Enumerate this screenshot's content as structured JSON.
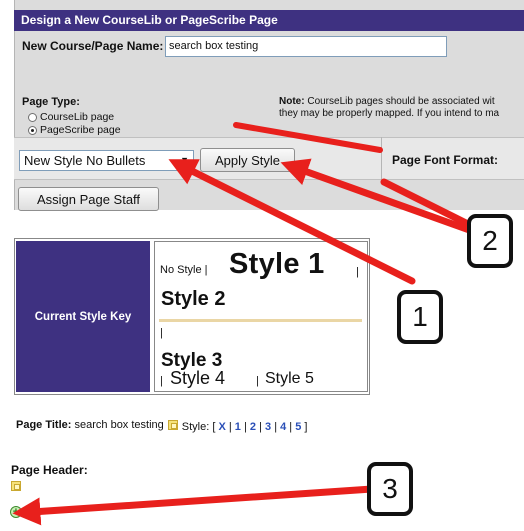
{
  "form": {
    "header": "Design a New CourseLib or PageScribe Page",
    "name_label": "New Course/Page Name:",
    "name_value": "search box testing",
    "page_type_label": "Page Type:",
    "page_type_options": [
      "CourseLib page",
      "PageScribe page"
    ],
    "page_type_selected": "PageScribe page",
    "note_label": "Note:",
    "note_line1": " CourseLib pages should be associated wit",
    "note_line2": "they may be properly mapped. If you intend to ma"
  },
  "toolbar": {
    "style_select_value": "New Style No Bullets",
    "apply_label": "Apply Style",
    "font_format_label": "Page Font Format:",
    "assign_label": "Assign Page Staff"
  },
  "style_key": {
    "label": "Current Style Key",
    "no_style": "No Style",
    "separator": "|",
    "style1": "Style 1",
    "style2": "Style 2",
    "style3": "Style 3",
    "style4": "Style 4",
    "style5": "Style 5"
  },
  "page_title": {
    "label": "Page Title:",
    "value": "search box testing",
    "style_label": "Style:",
    "links": [
      "X",
      "1",
      "2",
      "3",
      "4",
      "5"
    ]
  },
  "page_header": {
    "label": "Page Header:"
  },
  "callouts": {
    "one": "1",
    "two": "2",
    "three": "3"
  },
  "colors": {
    "header_bg": "#3e3181",
    "panel_bg": "#dcdcdc",
    "arrow": "#e8201c",
    "link": "#2a4fb7"
  },
  "icons": [
    "edit-icon",
    "add-icon",
    "dropdown-arrow-icon",
    "radio-icon"
  ]
}
